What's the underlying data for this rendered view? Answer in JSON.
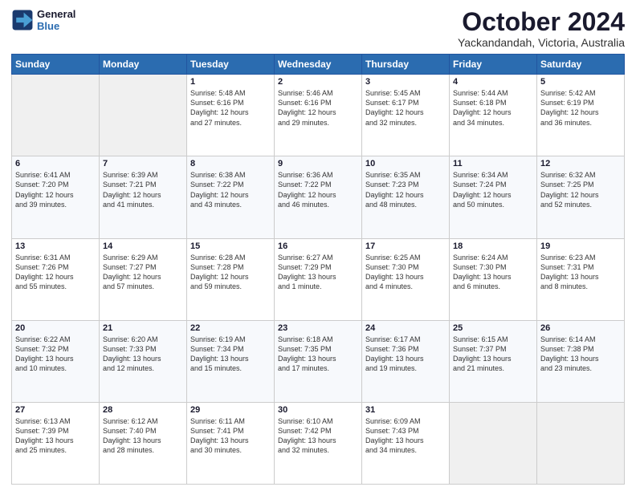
{
  "logo": {
    "line1": "General",
    "line2": "Blue"
  },
  "title": "October 2024",
  "subtitle": "Yackandandah, Victoria, Australia",
  "headers": [
    "Sunday",
    "Monday",
    "Tuesday",
    "Wednesday",
    "Thursday",
    "Friday",
    "Saturday"
  ],
  "weeks": [
    [
      {
        "day": "",
        "info": ""
      },
      {
        "day": "",
        "info": ""
      },
      {
        "day": "1",
        "info": "Sunrise: 5:48 AM\nSunset: 6:16 PM\nDaylight: 12 hours\nand 27 minutes."
      },
      {
        "day": "2",
        "info": "Sunrise: 5:46 AM\nSunset: 6:16 PM\nDaylight: 12 hours\nand 29 minutes."
      },
      {
        "day": "3",
        "info": "Sunrise: 5:45 AM\nSunset: 6:17 PM\nDaylight: 12 hours\nand 32 minutes."
      },
      {
        "day": "4",
        "info": "Sunrise: 5:44 AM\nSunset: 6:18 PM\nDaylight: 12 hours\nand 34 minutes."
      },
      {
        "day": "5",
        "info": "Sunrise: 5:42 AM\nSunset: 6:19 PM\nDaylight: 12 hours\nand 36 minutes."
      }
    ],
    [
      {
        "day": "6",
        "info": "Sunrise: 6:41 AM\nSunset: 7:20 PM\nDaylight: 12 hours\nand 39 minutes."
      },
      {
        "day": "7",
        "info": "Sunrise: 6:39 AM\nSunset: 7:21 PM\nDaylight: 12 hours\nand 41 minutes."
      },
      {
        "day": "8",
        "info": "Sunrise: 6:38 AM\nSunset: 7:22 PM\nDaylight: 12 hours\nand 43 minutes."
      },
      {
        "day": "9",
        "info": "Sunrise: 6:36 AM\nSunset: 7:22 PM\nDaylight: 12 hours\nand 46 minutes."
      },
      {
        "day": "10",
        "info": "Sunrise: 6:35 AM\nSunset: 7:23 PM\nDaylight: 12 hours\nand 48 minutes."
      },
      {
        "day": "11",
        "info": "Sunrise: 6:34 AM\nSunset: 7:24 PM\nDaylight: 12 hours\nand 50 minutes."
      },
      {
        "day": "12",
        "info": "Sunrise: 6:32 AM\nSunset: 7:25 PM\nDaylight: 12 hours\nand 52 minutes."
      }
    ],
    [
      {
        "day": "13",
        "info": "Sunrise: 6:31 AM\nSunset: 7:26 PM\nDaylight: 12 hours\nand 55 minutes."
      },
      {
        "day": "14",
        "info": "Sunrise: 6:29 AM\nSunset: 7:27 PM\nDaylight: 12 hours\nand 57 minutes."
      },
      {
        "day": "15",
        "info": "Sunrise: 6:28 AM\nSunset: 7:28 PM\nDaylight: 12 hours\nand 59 minutes."
      },
      {
        "day": "16",
        "info": "Sunrise: 6:27 AM\nSunset: 7:29 PM\nDaylight: 13 hours\nand 1 minute."
      },
      {
        "day": "17",
        "info": "Sunrise: 6:25 AM\nSunset: 7:30 PM\nDaylight: 13 hours\nand 4 minutes."
      },
      {
        "day": "18",
        "info": "Sunrise: 6:24 AM\nSunset: 7:30 PM\nDaylight: 13 hours\nand 6 minutes."
      },
      {
        "day": "19",
        "info": "Sunrise: 6:23 AM\nSunset: 7:31 PM\nDaylight: 13 hours\nand 8 minutes."
      }
    ],
    [
      {
        "day": "20",
        "info": "Sunrise: 6:22 AM\nSunset: 7:32 PM\nDaylight: 13 hours\nand 10 minutes."
      },
      {
        "day": "21",
        "info": "Sunrise: 6:20 AM\nSunset: 7:33 PM\nDaylight: 13 hours\nand 12 minutes."
      },
      {
        "day": "22",
        "info": "Sunrise: 6:19 AM\nSunset: 7:34 PM\nDaylight: 13 hours\nand 15 minutes."
      },
      {
        "day": "23",
        "info": "Sunrise: 6:18 AM\nSunset: 7:35 PM\nDaylight: 13 hours\nand 17 minutes."
      },
      {
        "day": "24",
        "info": "Sunrise: 6:17 AM\nSunset: 7:36 PM\nDaylight: 13 hours\nand 19 minutes."
      },
      {
        "day": "25",
        "info": "Sunrise: 6:15 AM\nSunset: 7:37 PM\nDaylight: 13 hours\nand 21 minutes."
      },
      {
        "day": "26",
        "info": "Sunrise: 6:14 AM\nSunset: 7:38 PM\nDaylight: 13 hours\nand 23 minutes."
      }
    ],
    [
      {
        "day": "27",
        "info": "Sunrise: 6:13 AM\nSunset: 7:39 PM\nDaylight: 13 hours\nand 25 minutes."
      },
      {
        "day": "28",
        "info": "Sunrise: 6:12 AM\nSunset: 7:40 PM\nDaylight: 13 hours\nand 28 minutes."
      },
      {
        "day": "29",
        "info": "Sunrise: 6:11 AM\nSunset: 7:41 PM\nDaylight: 13 hours\nand 30 minutes."
      },
      {
        "day": "30",
        "info": "Sunrise: 6:10 AM\nSunset: 7:42 PM\nDaylight: 13 hours\nand 32 minutes."
      },
      {
        "day": "31",
        "info": "Sunrise: 6:09 AM\nSunset: 7:43 PM\nDaylight: 13 hours\nand 34 minutes."
      },
      {
        "day": "",
        "info": ""
      },
      {
        "day": "",
        "info": ""
      }
    ]
  ]
}
